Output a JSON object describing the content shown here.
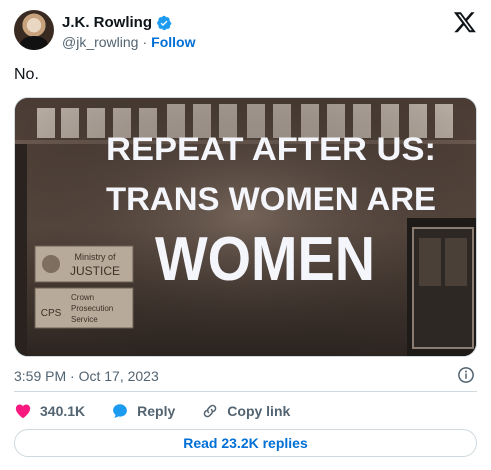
{
  "author": {
    "name": "J.K. Rowling",
    "handle": "@jk_rowling",
    "separator": "·",
    "follow_label": "Follow"
  },
  "tweet": {
    "text": "No.",
    "timestamp": "3:59 PM · Oct 17, 2023"
  },
  "media": {
    "projection_lines": [
      "REPEAT AFTER US:",
      "TRANS WOMEN ARE",
      "WOMEN"
    ],
    "sign_ministry_line1": "Ministry of",
    "sign_ministry_line2": "JUSTICE",
    "sign_cps_abbr": "CPS",
    "sign_cps_lines": [
      "Crown",
      "Prosecution",
      "Service"
    ]
  },
  "actions": {
    "like_count": "340.1K",
    "reply_label": "Reply",
    "copy_link_label": "Copy link",
    "read_replies_label": "Read 23.2K replies"
  },
  "colors": {
    "accent": "#006fd6",
    "like": "#f91880",
    "reply": "#1d9bf0",
    "text_secondary": "#536471"
  }
}
